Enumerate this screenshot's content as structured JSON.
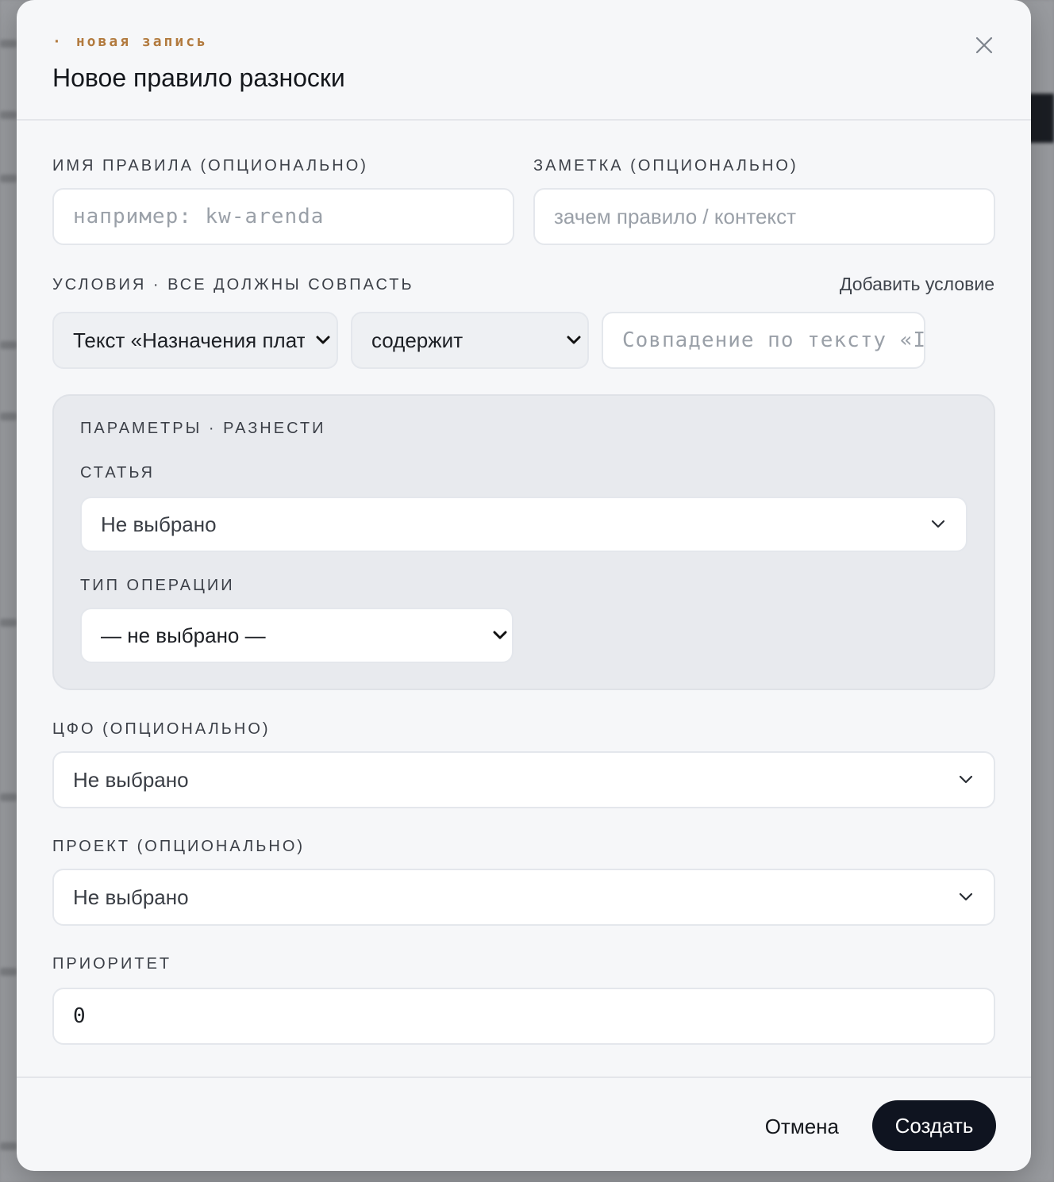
{
  "modal": {
    "eyebrow_dot": "·",
    "eyebrow": "новая запись",
    "title": "Новое правило разноски"
  },
  "fields": {
    "rule_name": {
      "label": "ИМЯ ПРАВИЛА (ОПЦИОНАЛЬНО)",
      "placeholder": "например: kw-arenda"
    },
    "note": {
      "label": "ЗАМЕТКА (ОПЦИОНАЛЬНО)",
      "placeholder": "зачем правило / контекст"
    }
  },
  "conditions": {
    "label": "УСЛОВИЯ · ВСЕ ДОЛЖНЫ СОВПАСТЬ",
    "add_label": "Добавить условие",
    "field_select": "Текст «Назначения платежа»",
    "operator_select": "содержит",
    "value_placeholder": "Совпадение по тексту «I"
  },
  "params": {
    "label": "ПАРАМЕТРЫ · РАЗНЕСТИ",
    "article": {
      "label": "СТАТЬЯ",
      "value": "Не выбрано"
    },
    "operation_type": {
      "label": "ТИП ОПЕРАЦИИ",
      "value": "— не выбрано —"
    }
  },
  "cfo": {
    "label": "ЦФО (ОПЦИОНАЛЬНО)",
    "value": "Не выбрано"
  },
  "project": {
    "label": "ПРОЕКТ (ОПЦИОНАЛЬНО)",
    "value": "Не выбрано"
  },
  "priority": {
    "label": "ПРИОРИТЕТ",
    "value": "0"
  },
  "footer": {
    "cancel_label": "Отмена",
    "create_label": "Создать"
  },
  "colors": {
    "accent": "#b27a3e",
    "primary_button": "#0f1420",
    "modal_bg": "#f6f7f9"
  }
}
